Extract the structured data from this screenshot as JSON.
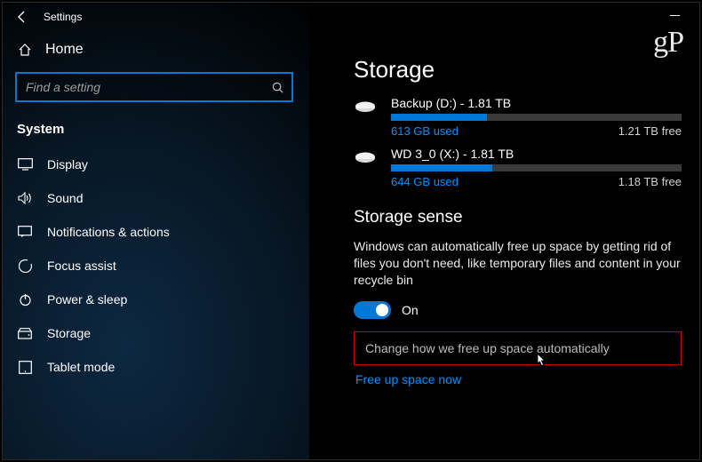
{
  "app": {
    "title": "Settings"
  },
  "sidebar": {
    "home_label": "Home",
    "search_placeholder": "Find a setting",
    "category": "System",
    "items": [
      {
        "label": "Display"
      },
      {
        "label": "Sound"
      },
      {
        "label": "Notifications & actions"
      },
      {
        "label": "Focus assist"
      },
      {
        "label": "Power & sleep"
      },
      {
        "label": "Storage"
      },
      {
        "label": "Tablet mode"
      }
    ]
  },
  "watermark": "gP",
  "page": {
    "title": "Storage",
    "drives": [
      {
        "name": "Backup (D:) - 1.81 TB",
        "used": "613 GB used",
        "free": "1.21 TB free",
        "pct": 33
      },
      {
        "name": "WD 3_0 (X:) - 1.81 TB",
        "used": "644 GB used",
        "free": "1.18 TB free",
        "pct": 35
      }
    ],
    "sense": {
      "title": "Storage sense",
      "desc": "Windows can automatically free up space by getting rid of files you don't need, like temporary files and content in your recycle bin",
      "toggle_state": "On",
      "change_link": "Change how we free up space automatically",
      "freeup_link": "Free up space now"
    }
  }
}
